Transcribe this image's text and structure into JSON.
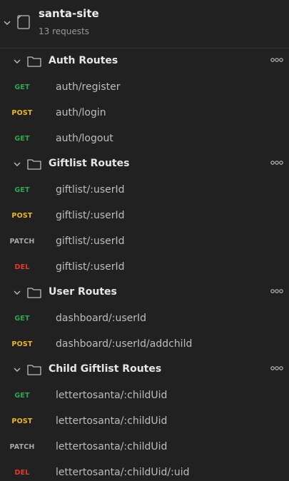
{
  "collection": {
    "name": "santa-site",
    "request_count": "13 requests"
  },
  "colors": {
    "GET": "#2fa84f",
    "POST": "#f0b429",
    "PATCH": "#a8a8a8",
    "DEL": "#e53935"
  },
  "icons": {
    "chevron": "chevron-down-icon",
    "collection": "collection-icon",
    "folder": "folder-icon",
    "more": "more-options-icon"
  },
  "folders": [
    {
      "name": "Auth Routes",
      "requests": [
        {
          "method": "GET",
          "name": "auth/register"
        },
        {
          "method": "POST",
          "name": "auth/login"
        },
        {
          "method": "GET",
          "name": "auth/logout"
        }
      ]
    },
    {
      "name": "Giftlist Routes",
      "requests": [
        {
          "method": "GET",
          "name": "giftlist/:userId"
        },
        {
          "method": "POST",
          "name": "giftlist/:userId"
        },
        {
          "method": "PATCH",
          "name": "giftlist/:userId"
        },
        {
          "method": "DEL",
          "name": "giftlist/:userId"
        }
      ]
    },
    {
      "name": "User Routes",
      "requests": [
        {
          "method": "GET",
          "name": "dashboard/:userId"
        },
        {
          "method": "POST",
          "name": "dashboard/:userId/addchild"
        }
      ]
    },
    {
      "name": "Child Giftlist Routes",
      "requests": [
        {
          "method": "GET",
          "name": "lettertosanta/:childUid"
        },
        {
          "method": "POST",
          "name": "lettertosanta/:childUid"
        },
        {
          "method": "PATCH",
          "name": "lettertosanta/:childUid"
        },
        {
          "method": "DEL",
          "name": "lettertosanta/:childUid/:uid"
        }
      ]
    }
  ]
}
